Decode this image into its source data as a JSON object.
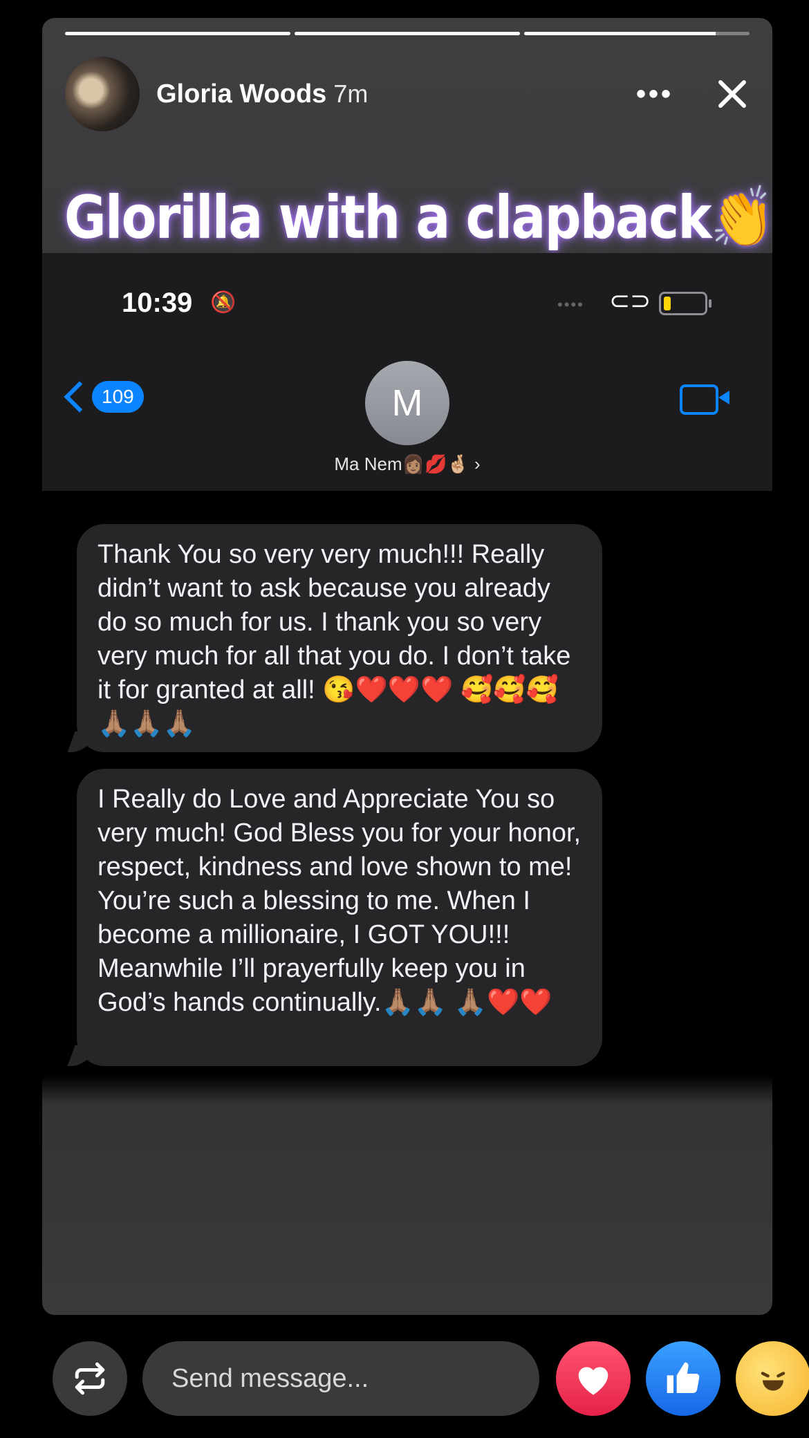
{
  "story": {
    "poster_name": "Gloria Woods",
    "time_ago": "7m",
    "progress": [
      1.0,
      1.0,
      0.85
    ],
    "more_icon": "more-dots-icon",
    "close_icon": "close-icon",
    "caption": "Glorilla with a clapback👏"
  },
  "phone": {
    "status": {
      "time": "10:39",
      "silent_icon": "🔕",
      "battery_level": 0.15
    },
    "back_count": "109",
    "contact_initial": "M",
    "contact_name": "Ma Nem👩🏽💋🤞🏼 ›"
  },
  "messages": [
    {
      "text": "Thank You so very very much!!! Really didn’t want to ask because you already do so much for us. I thank you so very very much for all that you do. I don’t take it for granted at all! 😘❤️❤️❤️ 🥰🥰🥰🙏🏽🙏🏽🙏🏽"
    },
    {
      "text": "I Really do Love and Appreciate You so very much! God Bless you for your honor, respect, kindness and love shown to me! You’re such a blessing to me. When I become a millionaire, I GOT YOU!!! Meanwhile I’ll prayerfully keep you in God’s hands continually.🙏🏽🙏🏽 🙏🏽❤️❤️"
    }
  ],
  "footer": {
    "send_placeholder": "Send message...",
    "share_icon": "share-icon",
    "reactions": [
      "heart-icon",
      "like-icon",
      "haha-icon"
    ]
  }
}
